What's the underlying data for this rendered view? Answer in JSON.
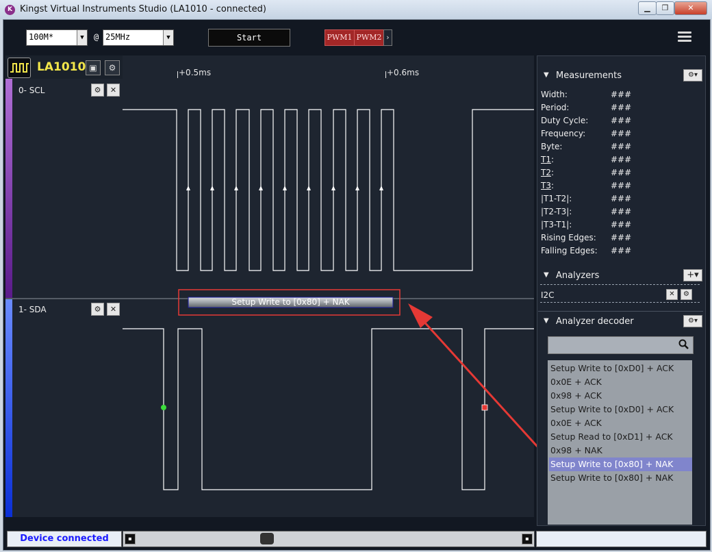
{
  "window": {
    "title": "Kingst Virtual Instruments Studio (LA1010 - connected)",
    "controls": {
      "minimize": "▁",
      "restore": "❐",
      "close": "✕"
    }
  },
  "toolbar": {
    "sample_depth": "100M*",
    "at": "@",
    "sample_rate": "25MHz",
    "start_label": "Start",
    "pwm1": "PWM1",
    "pwm2": "PWM2",
    "pwm_more": "›"
  },
  "device": {
    "name": "LA1010"
  },
  "timeline": {
    "markers": [
      "+0.5ms",
      "+0.6ms"
    ]
  },
  "channels": [
    {
      "label": "0-  SCL",
      "color_top": "#b06fd6",
      "color_bottom": "#5a1a8a"
    },
    {
      "label": "1-  SDA",
      "color_top": "#6a8bff",
      "color_bottom": "#0a2fd6"
    }
  ],
  "annotation": {
    "text": "Setup Write to [0x80] + NAK",
    "highlight_color": "#e53935"
  },
  "right_panel": {
    "measurements": {
      "title": "Measurements",
      "rows": [
        {
          "label": "Width:",
          "value": "###",
          "underline": false
        },
        {
          "label": "Period:",
          "value": "###",
          "underline": false
        },
        {
          "label": "Duty Cycle:",
          "value": "###",
          "underline": false
        },
        {
          "label": "Frequency:",
          "value": "###",
          "underline": false
        },
        {
          "label": "Byte:",
          "value": "###",
          "underline": false
        },
        {
          "label": "T1",
          "suffix": ":",
          "value": "###",
          "underline": true
        },
        {
          "label": "T2",
          "suffix": ":",
          "value": "###",
          "underline": true
        },
        {
          "label": "T3",
          "suffix": ":",
          "value": "###",
          "underline": true
        },
        {
          "label": "|T1-T2|:",
          "value": "###",
          "underline": false
        },
        {
          "label": "|T2-T3|:",
          "value": "###",
          "underline": false
        },
        {
          "label": "|T3-T1|:",
          "value": "###",
          "underline": false
        },
        {
          "label": "Rising Edges:",
          "value": "###",
          "underline": false
        },
        {
          "label": "Falling Edges:",
          "value": "###",
          "underline": false
        }
      ]
    },
    "analyzers": {
      "title": "Analyzers",
      "items": [
        "I2C"
      ]
    },
    "decoder": {
      "title": "Analyzer decoder",
      "search_placeholder": "",
      "items": [
        "Setup Write to [0xD0] + ACK",
        "0x0E + ACK",
        "0x98 + ACK",
        "Setup Write to [0xD0] + ACK",
        "0x0E + ACK",
        "Setup Read to [0xD1] + ACK",
        "0x98 + NAK",
        "Setup Write to [0x80] + NAK",
        "Setup Write to [0x80] + NAK"
      ],
      "selected_index": 7
    }
  },
  "status": {
    "device": "Device connected"
  }
}
